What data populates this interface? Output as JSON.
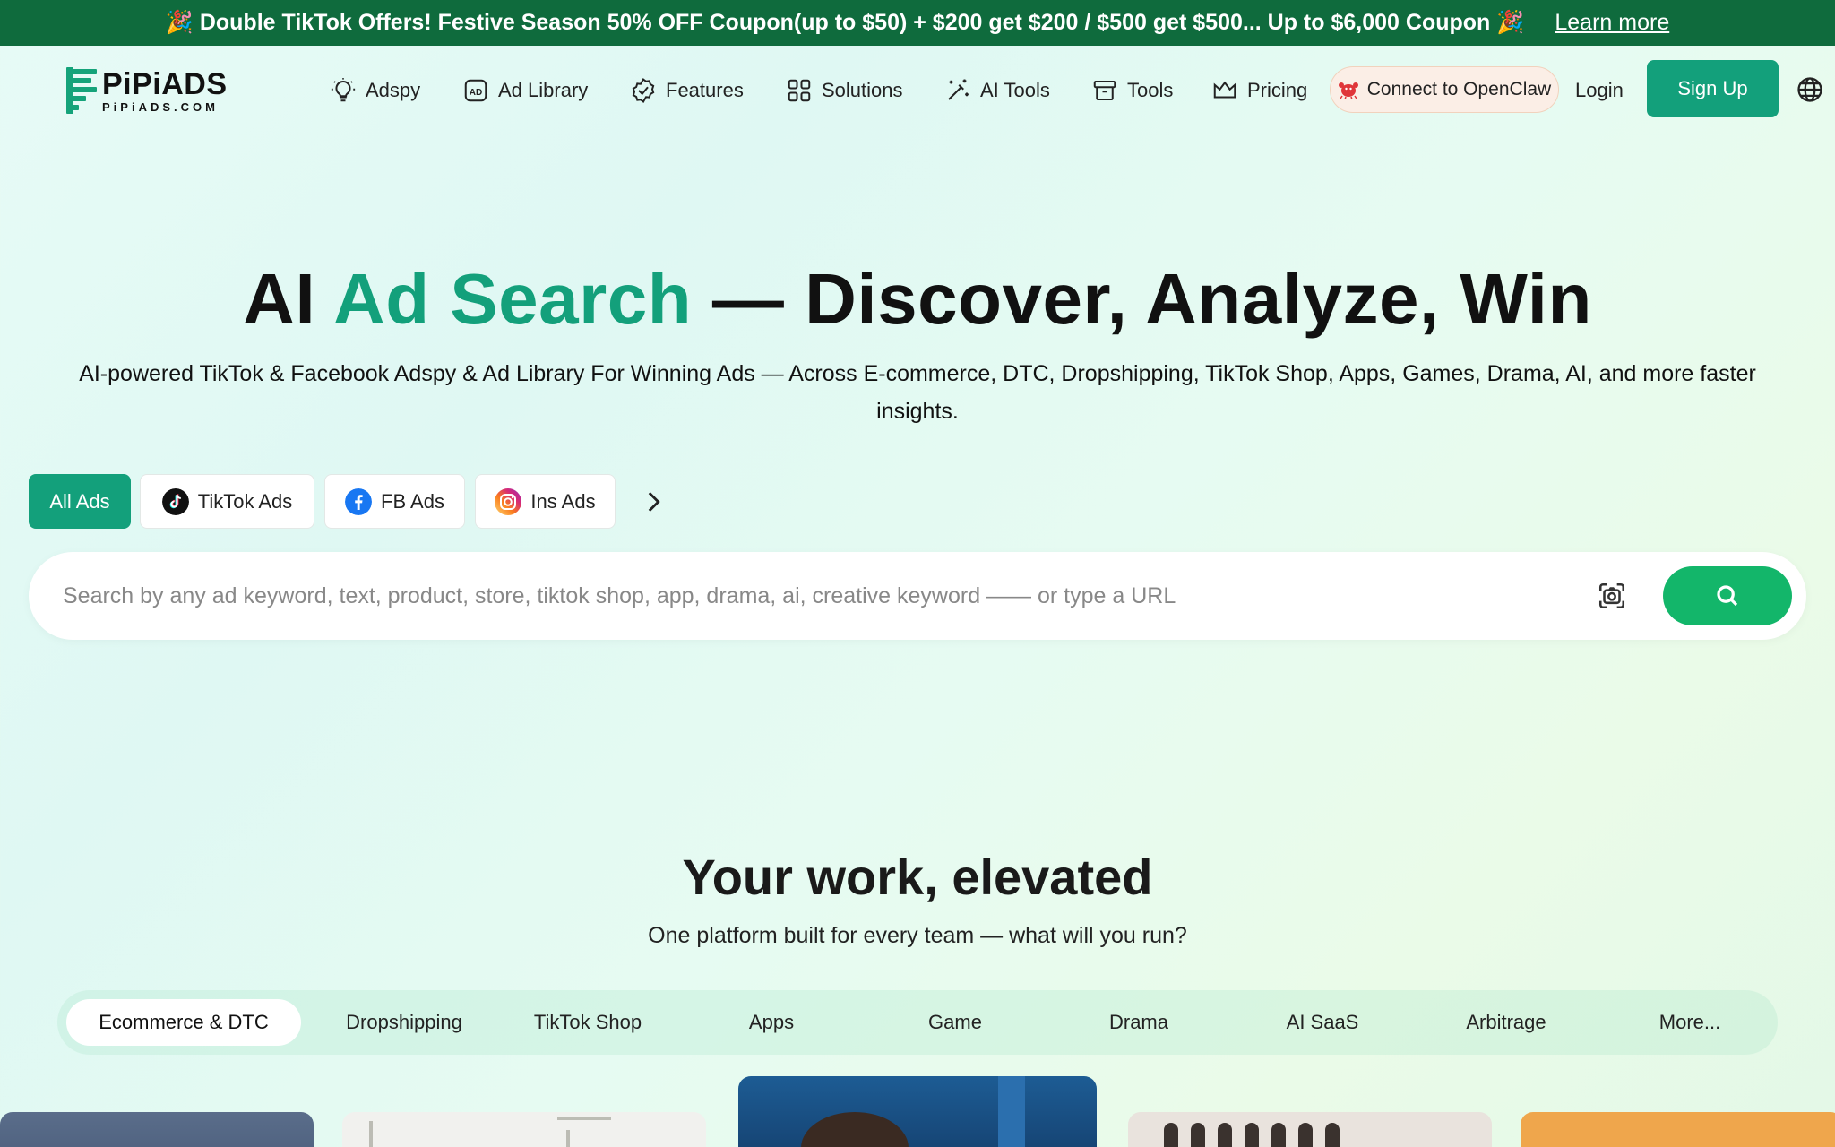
{
  "promo": {
    "text": "🎉 Double TikTok Offers! Festive Season 50% OFF Coupon(up to $50) + $200 get $200 / $500 get $500... Up to $6,000 Coupon 🎉",
    "learn_more": "Learn more"
  },
  "logo": {
    "name": "PiPiADS",
    "domain": "PiPiADS.COM"
  },
  "nav": {
    "adspy": "Adspy",
    "ad_library": "Ad Library",
    "features": "Features",
    "solutions": "Solutions",
    "ai_tools": "AI Tools",
    "tools": "Tools",
    "pricing": "Pricing",
    "openclaw": "Connect to OpenClaw",
    "login": "Login",
    "signup": "Sign Up"
  },
  "hero": {
    "title_pre": "AI ",
    "title_accent": "Ad Search",
    "title_post": " — Discover, Analyze, Win",
    "subtitle": "AI-powered TikTok & Facebook Adspy & Ad Library For Winning Ads — Across E-commerce, DTC, Dropshipping, TikTok Shop, Apps, Games, Drama, AI, and more faster insights."
  },
  "chips": {
    "all": "All Ads",
    "tiktok": "TikTok Ads",
    "fb": "FB Ads",
    "ins": "Ins Ads"
  },
  "search": {
    "placeholder": "Search by any ad keyword, text, product, store, tiktok shop, app, drama, ai, creative keyword —— or type a URL",
    "value": ""
  },
  "section": {
    "title": "Your work, elevated",
    "subtitle": "One platform built for every team — what will you run?",
    "tabs": [
      "Ecommerce & DTC",
      "Dropshipping",
      "TikTok Shop",
      "Apps",
      "Game",
      "Drama",
      "AI SaaS",
      "Arbitrage",
      "More..."
    ]
  },
  "colors": {
    "brand": "#13a07b",
    "promo_bg": "#0f6b3d",
    "search_button": "#13b66a"
  }
}
